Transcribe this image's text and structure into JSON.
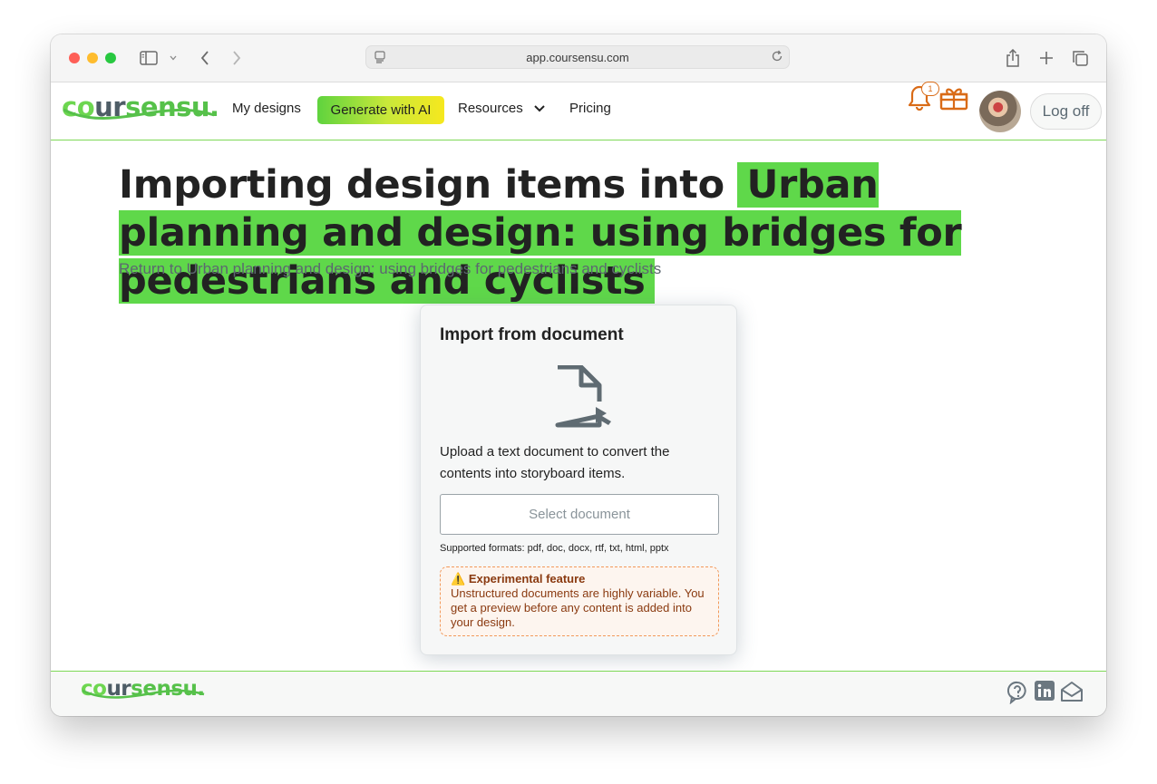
{
  "browser": {
    "url": "app.coursensu.com"
  },
  "nav": {
    "logo": {
      "part1": "co",
      "part2": "ur",
      "part3": "sensu."
    },
    "my_designs": "My designs",
    "generate_ai": "Generate with AI",
    "resources": "Resources",
    "pricing": "Pricing",
    "notification_count": "1",
    "logoff": "Log off"
  },
  "page": {
    "title_prefix": "Importing design items into ",
    "title_highlight": "Urban planning and design: using bridges for pedestrians and cyclists",
    "return_link": "Return to Urban planning and design: using bridges for pedestrians and cyclists"
  },
  "import_card": {
    "heading": "Import from document",
    "description": "Upload a text document to convert the contents into storyboard items.",
    "select_button": "Select document",
    "formats": "Supported formats: pdf, doc, docx, rtf, txt, html, pptx",
    "warning_icon": "⚠️",
    "warning_title": "Experimental feature",
    "warning_text": "Unstructured documents are highly variable. You get a preview before any content is added into your design."
  },
  "footer": {
    "logo": {
      "part1": "co",
      "part2": "ur",
      "part3": "sensu."
    }
  },
  "colors": {
    "brand_green": "#5fd84a",
    "accent_orange": "#d96b17"
  }
}
